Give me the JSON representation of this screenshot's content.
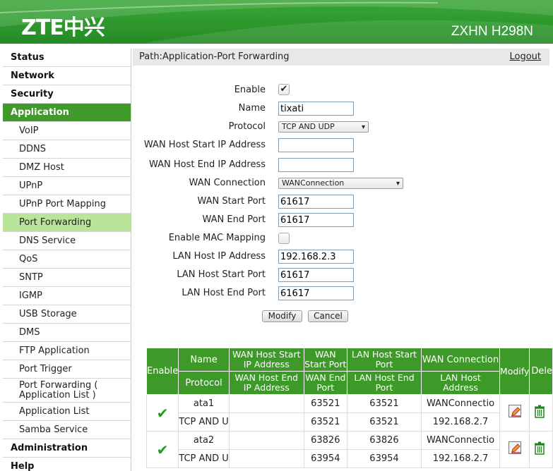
{
  "header": {
    "logo": "ZTE中兴",
    "model": "ZXHN H298N"
  },
  "sidebar": {
    "items": [
      {
        "label": "Status",
        "level": "top"
      },
      {
        "label": "Network",
        "level": "top"
      },
      {
        "label": "Security",
        "level": "top"
      },
      {
        "label": "Application",
        "level": "top",
        "active": true
      },
      {
        "label": "VoIP",
        "level": "sub"
      },
      {
        "label": "DDNS",
        "level": "sub"
      },
      {
        "label": "DMZ Host",
        "level": "sub"
      },
      {
        "label": "UPnP",
        "level": "sub"
      },
      {
        "label": "UPnP Port Mapping",
        "level": "sub"
      },
      {
        "label": "Port Forwarding",
        "level": "sub",
        "active": true
      },
      {
        "label": "DNS Service",
        "level": "sub"
      },
      {
        "label": "QoS",
        "level": "sub"
      },
      {
        "label": "SNTP",
        "level": "sub"
      },
      {
        "label": "IGMP",
        "level": "sub"
      },
      {
        "label": "USB Storage",
        "level": "sub"
      },
      {
        "label": "DMS",
        "level": "sub"
      },
      {
        "label": "FTP Application",
        "level": "sub"
      },
      {
        "label": "Port Trigger",
        "level": "sub"
      },
      {
        "label": "Port Forwarding ( Application List )",
        "level": "sub"
      },
      {
        "label": "Application List",
        "level": "sub"
      },
      {
        "label": "Samba Service",
        "level": "sub"
      },
      {
        "label": "Administration",
        "level": "top"
      },
      {
        "label": "Help",
        "level": "top"
      }
    ]
  },
  "path": {
    "text": "Path:Application-Port Forwarding",
    "logout": "Logout"
  },
  "form": {
    "enable_label": "Enable",
    "enable_checked": true,
    "name_label": "Name",
    "name_value": "tixati",
    "protocol_label": "Protocol",
    "protocol_value": "TCP AND UDP",
    "wan_host_start_label": "WAN Host Start IP Address",
    "wan_host_start_value": "",
    "wan_host_end_label": "WAN Host End IP Address",
    "wan_host_end_value": "",
    "wan_connection_label": "WAN Connection",
    "wan_connection_value": "WANConnection",
    "wan_start_port_label": "WAN Start Port",
    "wan_start_port_value": "61617",
    "wan_end_port_label": "WAN End Port",
    "wan_end_port_value": "61617",
    "mac_mapping_label": "Enable MAC Mapping",
    "mac_mapping_checked": false,
    "lan_host_ip_label": "LAN Host IP Address",
    "lan_host_ip_value": "192.168.2.3",
    "lan_host_start_label": "LAN Host Start Port",
    "lan_host_start_value": "61617",
    "lan_host_end_label": "LAN Host End Port",
    "lan_host_end_value": "61617",
    "modify_button": "Modify",
    "cancel_button": "Cancel"
  },
  "table": {
    "headers": {
      "enable": "Enable",
      "name": "Name",
      "protocol": "Protocol",
      "wan_host_start": "WAN Host Start IP Address",
      "wan_host_end": "WAN Host End IP Address",
      "wan_start_port": "WAN Start Port",
      "wan_end_port": "WAN End Port",
      "lan_host_start_port": "LAN Host Start Port",
      "lan_host_end_port": "LAN Host End Port",
      "wan_connection": "WAN Connection",
      "lan_host_address": "LAN Host Address",
      "modify": "Modify",
      "delete": "Dele"
    },
    "rows": [
      {
        "name": "ata1",
        "protocol": "TCP AND U",
        "wan_host_start": "",
        "wan_host_end": "",
        "wan_start_port": "63521",
        "wan_end_port": "63521",
        "lan_start_port": "63521",
        "lan_end_port": "63521",
        "wan_connection": "WANConnectio",
        "lan_host": "192.168.2.7"
      },
      {
        "name": "ata2",
        "protocol": "TCP AND U",
        "wan_host_start": "",
        "wan_host_end": "",
        "wan_start_port": "63826",
        "wan_end_port": "63954",
        "lan_start_port": "63826",
        "lan_end_port": "63954",
        "wan_connection": "WANConnectio",
        "lan_host": "192.168.2.7"
      }
    ]
  },
  "colors": {
    "brand_green": "#3f9a2b",
    "active_sub": "#b9e49a"
  }
}
